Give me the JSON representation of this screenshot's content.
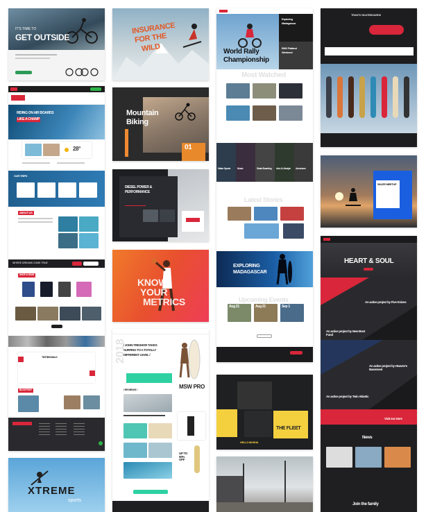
{
  "colors": {
    "accent_red": "#d9263a",
    "accent_orange": "#f26a28",
    "accent_yellow": "#f4d03f",
    "accent_teal": "#2fd1a2",
    "dark": "#1c1d21",
    "sky": "#4f8ec7"
  },
  "col1": {
    "card1": {
      "kicker": "IT'S TIME TO",
      "headline": "GET OUTSIDE"
    },
    "card2": {
      "headline_1": "RIDING ON AIR BOARDS",
      "headline_2": "LIKE A CHAMP",
      "temp": "28°",
      "section": "OUR TRIPS",
      "about": "ABOUT US",
      "cta": "WHERE DREAMS COME TRUE",
      "shop": "SHOP & GEAR",
      "testimonials": "TESTIMONIALS",
      "blog": "BLOG POST"
    },
    "card3": {
      "logo_1": "XTREME",
      "logo_2": "sports"
    }
  },
  "col2": {
    "card1": {
      "headline_1": "INSURANCE",
      "headline_2": "FOR THE",
      "headline_3": "WILD"
    },
    "card2": {
      "headline_1": "Mountain",
      "headline_2": "Biking",
      "number": "01"
    },
    "card3": {
      "headline_1": "DIESEL POWER &",
      "headline_2": "PERFORMANCE"
    },
    "card4": {
      "headline_1": "KNOW",
      "headline_2": "YOUR",
      "headline_3": "METRICS"
    },
    "card5": {
      "quote_1": "/ JOHN TRESHOR TAKES",
      "quote_2": "SURFING TO A TOTALLY",
      "quote_3": "DIFFERENT LEVEL /",
      "side": "2018",
      "mswpro": "MSW PRO",
      "reviews": "/ REVIEWS /",
      "upto": "UP TO 50% OFF"
    }
  },
  "col3": {
    "card1": {
      "badge_1": "Exploring",
      "badge_2": "Madagascar",
      "badge_3": "BMX Flatland",
      "badge_4": "Weekend",
      "headline_1": "World Rally",
      "headline_2": "Championship",
      "most_watched": "Most Watched"
    },
    "card2": {
      "tiles": [
        "Water Sports",
        "Music",
        "Skate Boarding",
        "Arts & Lifestyle",
        "Adventure"
      ],
      "latest": "Latest Stories"
    },
    "card3": {
      "headline_1": "EXPLORING",
      "headline_2": "MADAGASCAR",
      "upcoming": "Upcoming Events",
      "dates": [
        "Aug 21",
        "Aug 21",
        "Sep 1"
      ]
    },
    "card4": {
      "headline": "THE FLEET",
      "sub": "HELLO MOSHA"
    }
  },
  "col4": {
    "card1": {
      "brand": "TRANTO SKATEBOARDS"
    },
    "card2": {
      "panel": "SKATE MEETUP"
    },
    "card3": {
      "headline": "HEART & SOUL",
      "projects": [
        "An active project by Five Knives",
        "An active project by New Boot Fund",
        "An active project by Heaven's Basement",
        "An active project by Twin Atlantic"
      ],
      "visit": "Visit our store",
      "news": "News",
      "join": "Join the family"
    }
  }
}
